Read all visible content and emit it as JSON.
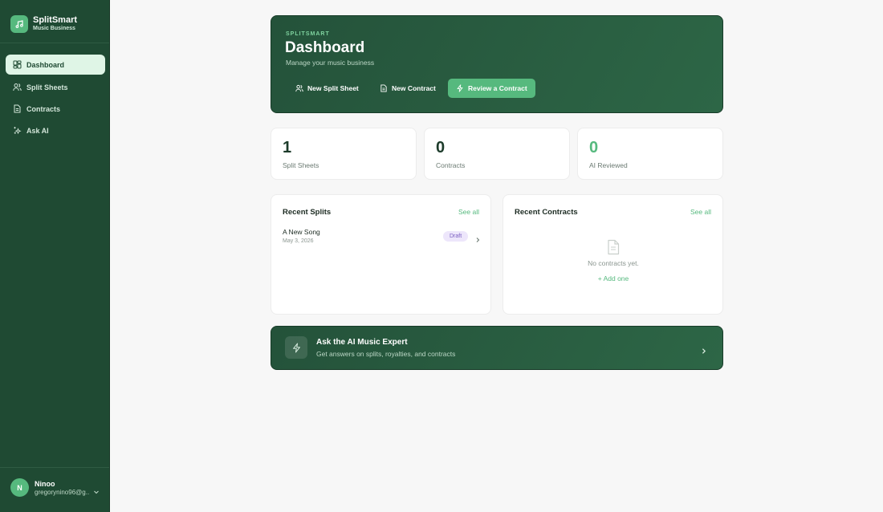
{
  "brand": {
    "name": "SplitSmart",
    "subtitle": "Music Business",
    "logo_icon": "music-note-icon"
  },
  "nav": [
    {
      "label": "Dashboard",
      "icon": "dashboard-icon",
      "active": true
    },
    {
      "label": "Split Sheets",
      "icon": "users-icon",
      "active": false
    },
    {
      "label": "Contracts",
      "icon": "document-icon",
      "active": false
    },
    {
      "label": "Ask AI",
      "icon": "sparkles-icon",
      "active": false
    }
  ],
  "user": {
    "initial": "N",
    "name": "Ninoo",
    "email": "gregorynino96@g..."
  },
  "hero": {
    "eyebrow": "SPLITSMART",
    "title": "Dashboard",
    "subtitle": "Manage your music business",
    "buttons": [
      {
        "label": "New Split Sheet",
        "icon": "users-icon"
      },
      {
        "label": "New Contract",
        "icon": "document-icon"
      },
      {
        "label": "Review a Contract",
        "icon": "lightning-icon"
      }
    ]
  },
  "stats": [
    {
      "value": "1",
      "label": "Split Sheets"
    },
    {
      "value": "0",
      "label": "Contracts"
    },
    {
      "value": "0",
      "label": "AI Reviewed"
    }
  ],
  "recent_splits": {
    "title": "Recent Splits",
    "see_all": "See all",
    "items": [
      {
        "name": "A New Song",
        "date": "May 3, 2026",
        "status": "Draft"
      }
    ]
  },
  "recent_contracts": {
    "title": "Recent Contracts",
    "see_all": "See all",
    "empty_text": "No contracts yet.",
    "add_label": "+ Add one"
  },
  "ai_banner": {
    "title": "Ask the AI Music Expert",
    "subtitle": "Get answers on splits, royalties, and contracts"
  },
  "colors": {
    "sidebar": "#1f4a33",
    "accent": "#56b97e",
    "hero_bg": "#24523a",
    "draft_badge": "#ede6fb"
  }
}
